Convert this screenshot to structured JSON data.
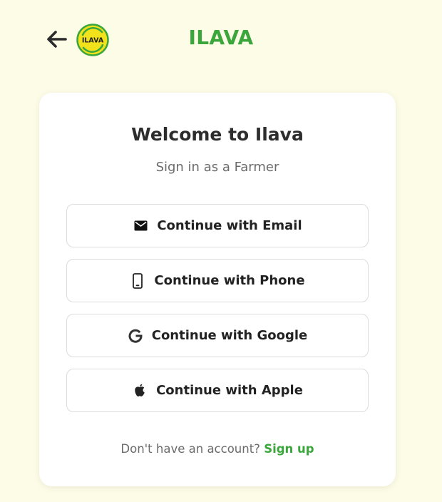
{
  "header": {
    "title": "ILAVA",
    "logo_text": "ILAVA",
    "back_icon": "arrow-left-icon"
  },
  "card": {
    "title": "Welcome to Ilava",
    "subtitle": "Sign in as a Farmer"
  },
  "auth_options": [
    {
      "label": "Continue with Email",
      "icon": "mail-icon"
    },
    {
      "label": "Continue with Phone",
      "icon": "phone-icon"
    },
    {
      "label": "Continue with Google",
      "icon": "google-icon"
    },
    {
      "label": "Continue with Apple",
      "icon": "apple-icon"
    }
  ],
  "footer": {
    "prompt": "Don't have an account?",
    "link": "Sign up"
  },
  "colors": {
    "background": "#fdfce6",
    "brand_green": "#3aa63c",
    "logo_yellow": "#f2e21b",
    "card": "#ffffff"
  }
}
